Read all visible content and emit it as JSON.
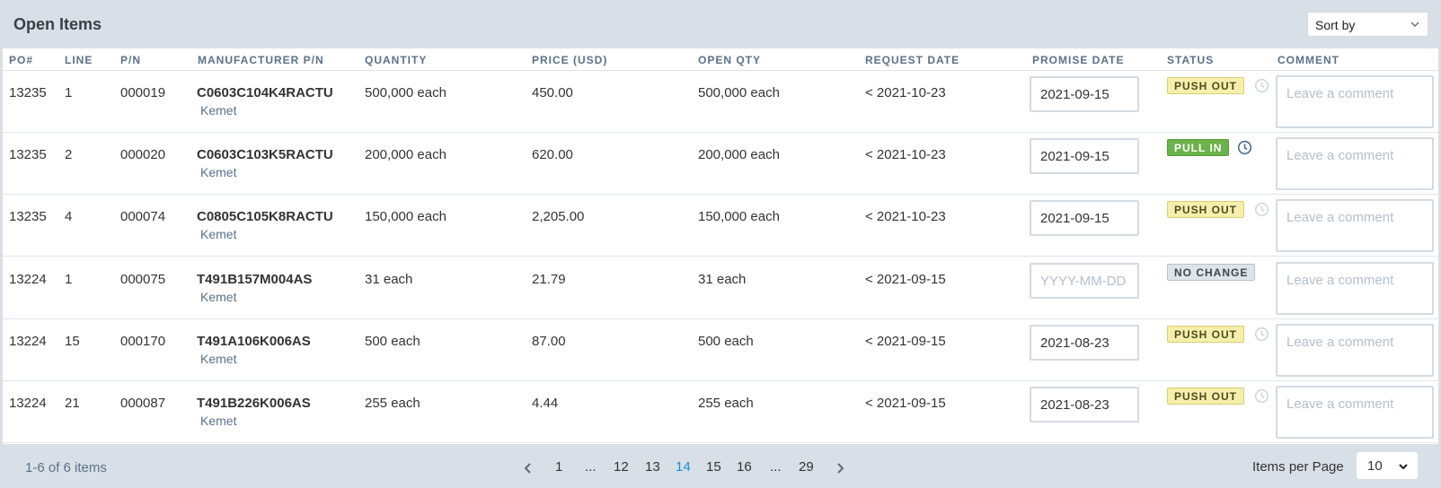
{
  "header": {
    "title": "Open Items",
    "sort_label": "Sort by"
  },
  "columns": [
    "PO#",
    "LINE",
    "P/N",
    "MANUFACTURER P/N",
    "QUANTITY",
    "PRICE (USD)",
    "OPEN QTY",
    "REQUEST DATE",
    "PROMISE DATE",
    "STATUS",
    "COMMENT"
  ],
  "rows": [
    {
      "po": "13235",
      "line": "1",
      "pn": "000019",
      "mfr_pn": "C0603C104K4RACTU",
      "mfr": "Kemet",
      "quantity": "500,000 each",
      "price": "450.00",
      "open_qty": "500,000 each",
      "request_date": "< 2021-10-23",
      "promise_date": "2021-09-15",
      "status": "PUSH OUT",
      "comment": ""
    },
    {
      "po": "13235",
      "line": "2",
      "pn": "000020",
      "mfr_pn": "C0603C103K5RACTU",
      "mfr": "Kemet",
      "quantity": "200,000 each",
      "price": "620.00",
      "open_qty": "200,000 each",
      "request_date": "< 2021-10-23",
      "promise_date": "2021-09-15",
      "status": "PULL IN",
      "comment": ""
    },
    {
      "po": "13235",
      "line": "4",
      "pn": "000074",
      "mfr_pn": "C0805C105K8RACTU",
      "mfr": "Kemet",
      "quantity": "150,000 each",
      "price": "2,205.00",
      "open_qty": "150,000 each",
      "request_date": "< 2021-10-23",
      "promise_date": "2021-09-15",
      "status": "PUSH OUT",
      "comment": ""
    },
    {
      "po": "13224",
      "line": "1",
      "pn": "000075",
      "mfr_pn": "T491B157M004AS",
      "mfr": "Kemet",
      "quantity": "31 each",
      "price": "21.79",
      "open_qty": "31 each",
      "request_date": "< 2021-09-15",
      "promise_date": "",
      "status": "NO CHANGE",
      "comment": ""
    },
    {
      "po": "13224",
      "line": "15",
      "pn": "000170",
      "mfr_pn": "T491A106K006AS",
      "mfr": "Kemet",
      "quantity": "500 each",
      "price": "87.00",
      "open_qty": "500 each",
      "request_date": "< 2021-09-15",
      "promise_date": "2021-08-23",
      "status": "PUSH OUT",
      "comment": ""
    },
    {
      "po": "13224",
      "line": "21",
      "pn": "000087",
      "mfr_pn": "T491B226K006AS",
      "mfr": "Kemet",
      "quantity": "255 each",
      "price": "4.44",
      "open_qty": "255 each",
      "request_date": "< 2021-09-15",
      "promise_date": "2021-08-23",
      "status": "PUSH OUT",
      "comment": ""
    }
  ],
  "date_placeholder": "YYYY-MM-DD",
  "comment_placeholder": "Leave a comment",
  "footer": {
    "count": "1-6 of 6 items",
    "pages": [
      "1",
      "...",
      "12",
      "13",
      "14",
      "15",
      "16",
      "...",
      "29"
    ],
    "active_page": "14",
    "items_per_page_label": "Items per Page",
    "items_per_page": "10"
  },
  "icons": {
    "sort_chevron": "chevron-down-icon",
    "prev": "chevron-left-icon",
    "next": "chevron-right-icon",
    "status_history": "clock-icon"
  },
  "colors": {
    "push_out_bg": "#f5efac",
    "pull_in_bg": "#6cb24a",
    "no_change_bg": "#dfe4e9",
    "active_page": "#1a8fd2",
    "header_text": "#5b7189"
  }
}
